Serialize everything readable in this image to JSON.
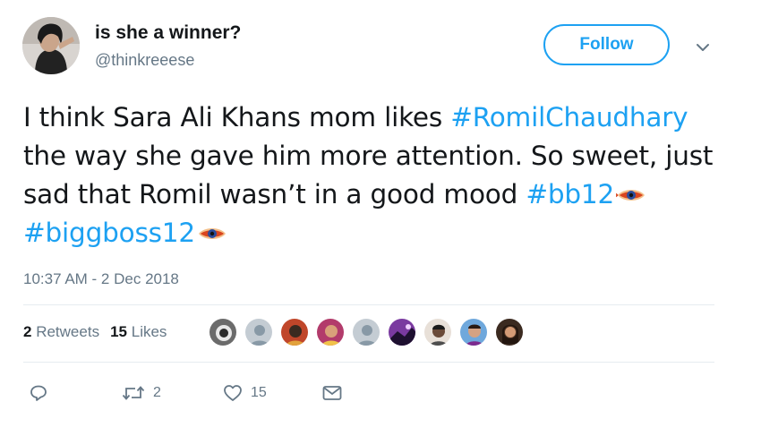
{
  "author": {
    "display_name": "is she a winner?",
    "handle": "@thinkreeese"
  },
  "follow_label": "Follow",
  "tweet": {
    "text_1": "I think Sara Ali Khans mom likes ",
    "hashtag_1": "#RomilChaudhary",
    "text_2": " the way she gave him more attention. So sweet, just sad that Romil wasn’t in a good mood ",
    "hashtag_2": "#bb12",
    "hashtag_3": "#biggboss12"
  },
  "timestamp": "10:37 AM - 2 Dec 2018",
  "stats": {
    "retweets_count": "2",
    "retweets_label": "Retweets",
    "likes_count": "15",
    "likes_label": "Likes"
  },
  "actions": {
    "retweet_count": "2",
    "like_count": "15"
  },
  "icons": {
    "caret": "chevron-down-icon",
    "reply": "reply-icon",
    "retweet": "retweet-icon",
    "like": "heart-icon",
    "message": "envelope-icon",
    "hashtag_emoji": "bigg-boss-eye-icon"
  },
  "colors": {
    "accent": "#1da1f2",
    "secondary_text": "#657786",
    "primary_text": "#14171a",
    "divider": "#e6ecf0"
  }
}
